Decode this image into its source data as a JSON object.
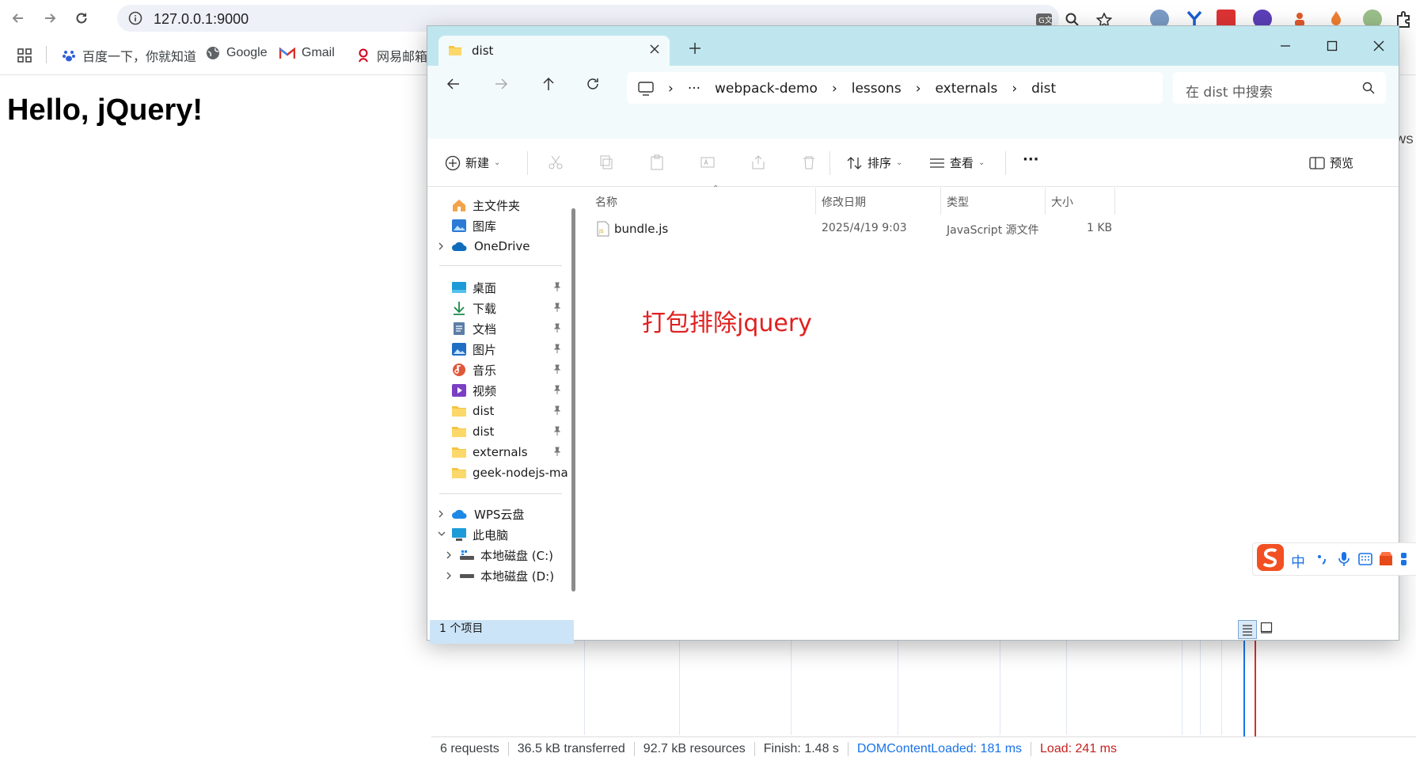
{
  "browser": {
    "url": "127.0.0.1:9000",
    "bookmarks": [
      {
        "label": "百度一下，你就知道",
        "icon": "baidu-icon"
      },
      {
        "label": "Google",
        "icon": "globe-icon"
      },
      {
        "label": "Gmail",
        "icon": "gmail-icon"
      },
      {
        "label": "网易邮箱",
        "icon": "netease-icon"
      }
    ]
  },
  "page": {
    "heading": "Hello, jQuery!"
  },
  "devtools": {
    "requests": "6 requests",
    "transferred": "36.5 kB transferred",
    "resources": "92.7 kB resources",
    "finish": "Finish: 1.48 s",
    "dcl": "DOMContentLoaded: 181 ms",
    "load": "Load: 241 ms",
    "side_label": "WS"
  },
  "explorer": {
    "tab_title": "dist",
    "breadcrumbs": [
      "webpack-demo",
      "lessons",
      "externals",
      "dist"
    ],
    "search_placeholder": "在 dist 中搜索",
    "toolbar": {
      "new": "新建",
      "sort": "排序",
      "view": "查看",
      "more": "···",
      "preview": "预览"
    },
    "nav": {
      "home": "主文件夹",
      "gallery": "图库",
      "onedrive": "OneDrive",
      "desktop": "桌面",
      "downloads": "下载",
      "documents": "文档",
      "pictures": "图片",
      "music": "音乐",
      "videos": "视频",
      "dist1": "dist",
      "dist2": "dist",
      "externals": "externals",
      "geek": "geek-nodejs-ma",
      "wps": "WPS云盘",
      "thispc": "此电脑",
      "drive_c": "本地磁盘 (C:)",
      "drive_d": "本地磁盘 (D:)"
    },
    "columns": {
      "name": "名称",
      "modified": "修改日期",
      "type": "类型",
      "size": "大小"
    },
    "files": [
      {
        "name": "bundle.js",
        "modified": "2025/4/19 9:03",
        "type": "JavaScript 源文件",
        "size": "1 KB"
      }
    ],
    "annotation": "打包排除jquery",
    "status": "1 个项目"
  },
  "ime": {
    "lang": "中"
  },
  "colors": {
    "accent": "#1a73e8",
    "annotation": "#e02020",
    "titlebar": "#bfe6ee",
    "selected": "#cce4f7"
  }
}
